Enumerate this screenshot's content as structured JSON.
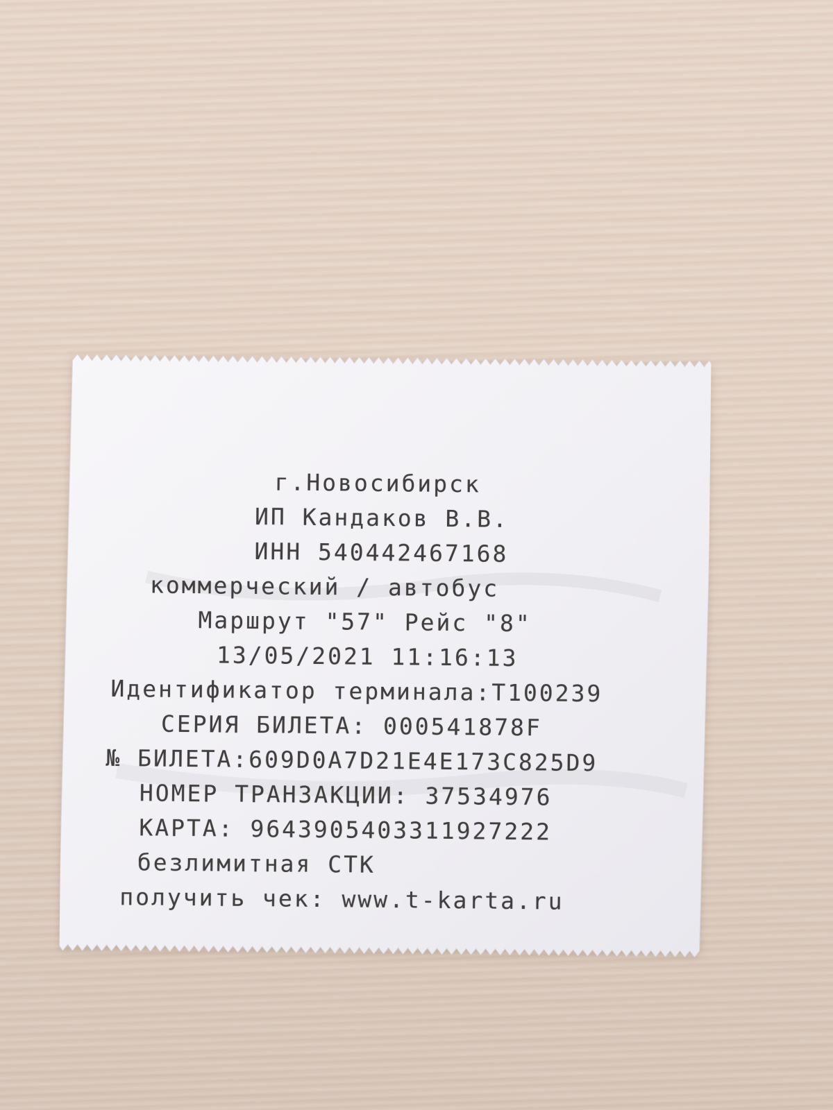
{
  "receipt": {
    "city": "г.Новосибирск",
    "merchant": "ИП Кандаков В.В.",
    "inn": "ИНН 540442467168",
    "transport_type": "коммерческий / автобус",
    "route": "Маршрут \"57\" Рейс \"8\"",
    "datetime": "13/05/2021 11:16:13",
    "terminal_id": "Идентификатор терминала:T100239",
    "ticket_series": "СЕРИЯ БИЛЕТА: 000541878F",
    "ticket_number": "№ БИЛЕТА:609D0A7D21E4E173C825D9",
    "transaction_number": "НОМЕР ТРАНЗАКЦИИ: 37534976",
    "card": "КАРТА: 9643905403311927222",
    "tariff": "безлимитная СТК",
    "receipt_link": "получить чек: www.t-karta.ru"
  },
  "colors": {
    "paper": "#f4f3f6",
    "ink": "#2a2626",
    "surface": "#e3d2c4"
  }
}
